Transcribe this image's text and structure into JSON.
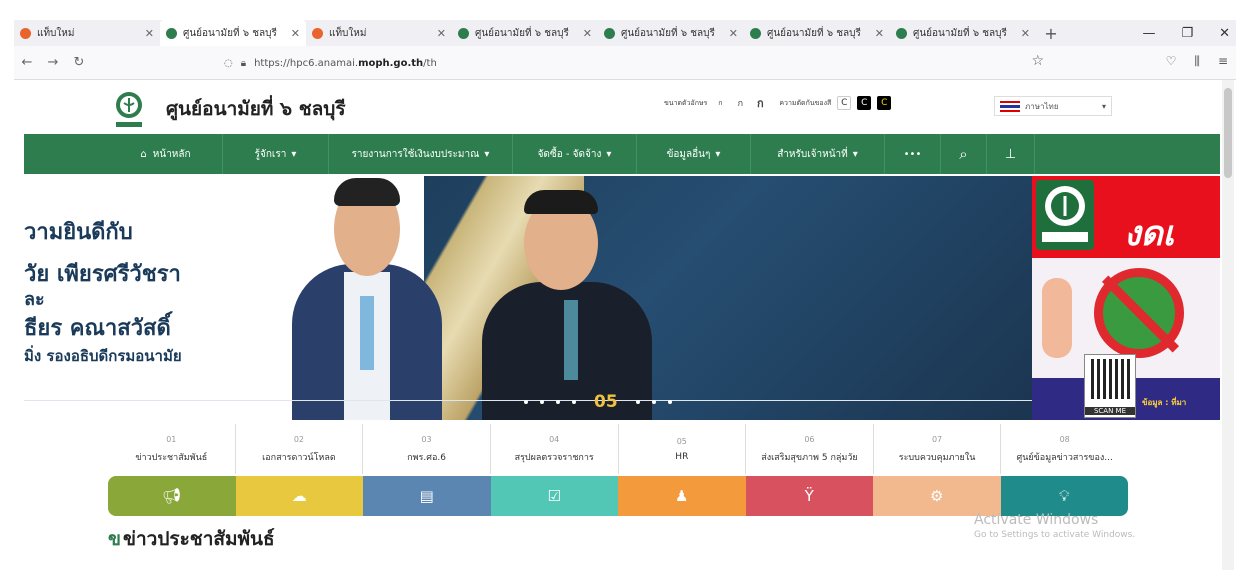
{
  "browser": {
    "tabs": [
      {
        "title": "แท็บใหม่",
        "fav_color": "#e8642c"
      },
      {
        "title": "ศูนย์อนามัยที่ ๖ ชลบุรี",
        "fav_color": "#2e7d4f"
      },
      {
        "title": "แท็บใหม่",
        "fav_color": "#e8642c"
      },
      {
        "title": "ศูนย์อนามัยที่ ๖ ชลบุรี",
        "fav_color": "#2e7d4f"
      },
      {
        "title": "ศูนย์อนามัยที่ ๖ ชลบุรี",
        "fav_color": "#2e7d4f"
      },
      {
        "title": "ศูนย์อนามัยที่ ๖ ชลบุรี",
        "fav_color": "#2e7d4f"
      },
      {
        "title": "ศูนย์อนามัยที่ ๖ ชลบุรี",
        "fav_color": "#2e7d4f"
      }
    ],
    "url_pre": "https://hpc6.anamai.",
    "url_bold": "moph.go.th",
    "url_post": "/th"
  },
  "header": {
    "title": "ศูนย์อนามัยที่ ๖ ชลบุรี",
    "font_size_label": "ขนาดตัวอักษร",
    "font_buttons": [
      "ก",
      "ก",
      "ก"
    ],
    "contrast_label": "ความตัดกันของสี",
    "contrast_buttons": [
      "C",
      "C",
      "C"
    ],
    "language": "ภาษาไทย"
  },
  "menu": {
    "items": [
      "หน้าหลัก",
      "รู้จักเรา",
      "รายงานการใช้เงินงบประมาณ",
      "จัดซื้อ - จัดจ้าง",
      "ข้อมูลอื่นๆ",
      "สำหรับเจ้าหน้าที่"
    ],
    "more": "•••"
  },
  "banner": {
    "line1": "วามยินดีกับ",
    "line2": "วัย เพียรศรีวัชรา",
    "line3": "ละ",
    "line4": "ธียร คณาสวัสดิ์",
    "line5": "มิ่ง รองอธิบดีกรมอนามัย",
    "slide_number": "05",
    "right_title": "งดเ",
    "qr_label": "SCAN ME",
    "right_source": "ข้อมูล : ที่มา"
  },
  "quick_tabs": [
    {
      "num": "01",
      "label": "ข่าวประชาสัมพันธ์"
    },
    {
      "num": "02",
      "label": "เอกสารดาวน์โหลด"
    },
    {
      "num": "03",
      "label": "กพร.ศอ.6"
    },
    {
      "num": "04",
      "label": "สรุปผลตรวจราชการ"
    },
    {
      "num": "05",
      "label": "HR"
    },
    {
      "num": "06",
      "label": "ส่งเสริมสุขภาพ 5 กลุ่มวัย"
    },
    {
      "num": "07",
      "label": "ระบบควบคุมภายใน"
    },
    {
      "num": "08",
      "label": "ศูนย์ข้อมูลข่าวสารของ..."
    }
  ],
  "icon_bar": [
    {
      "icon": "megaphone-icon",
      "color": "#8aa83a"
    },
    {
      "icon": "cloud-download-icon",
      "color": "#e8c83e"
    },
    {
      "icon": "document-icon",
      "color": "#5b86b1"
    },
    {
      "icon": "clipboard-check-icon",
      "color": "#52c7b5"
    },
    {
      "icon": "person-icon",
      "color": "#f39a3c"
    },
    {
      "icon": "family-icon",
      "color": "#d8515e"
    },
    {
      "icon": "gear-icon",
      "color": "#f2b98e"
    },
    {
      "icon": "lightbulb-icon",
      "color": "#1f8b8b"
    }
  ],
  "news_heading": "ข่าวประชาสัมพันธ์",
  "news_mark": "ข",
  "watermark": {
    "line1": "Activate Windows",
    "line2": "Go to Settings to activate Windows."
  }
}
